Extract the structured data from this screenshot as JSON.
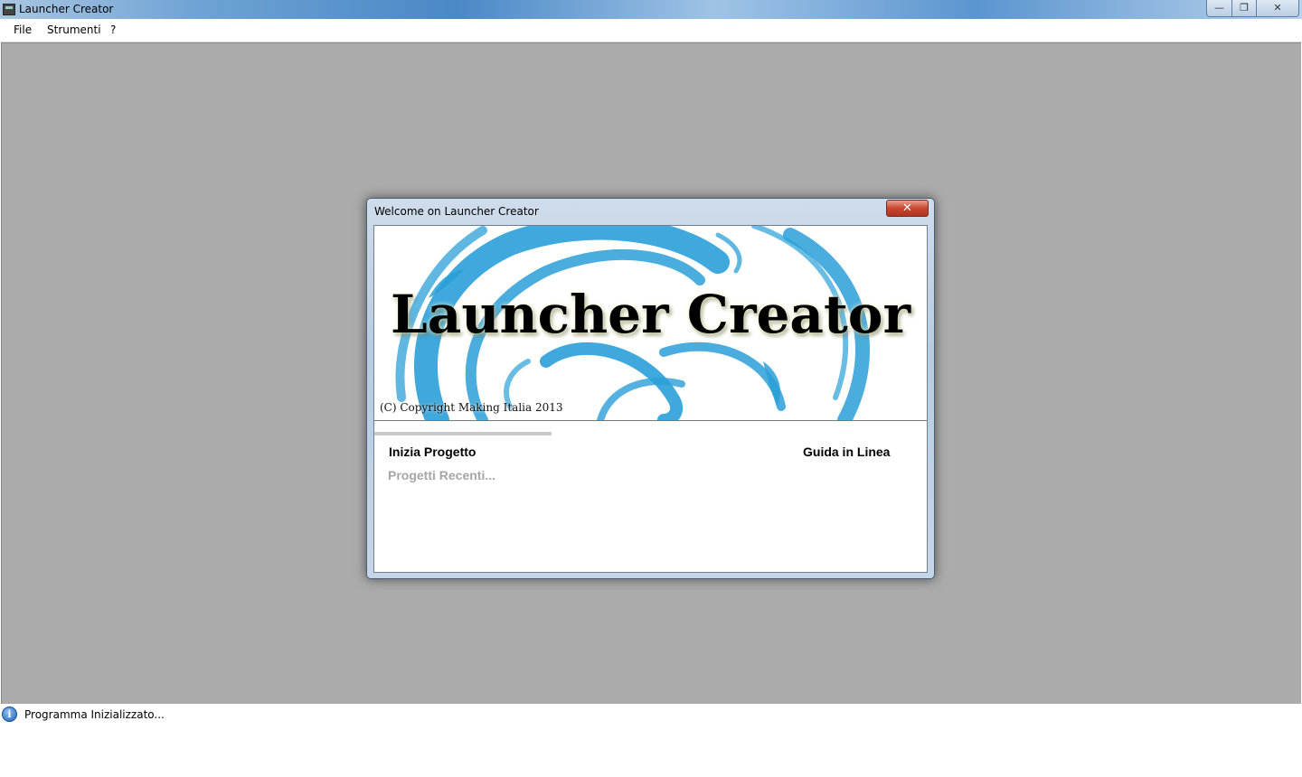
{
  "window": {
    "title": "Launcher Creator",
    "controls": {
      "minimize": "—",
      "maximize": "❐",
      "close": "✕"
    }
  },
  "menubar": {
    "items": [
      "File",
      "Strumenti",
      "?"
    ]
  },
  "dialog": {
    "title": "Welcome on Launcher Creator",
    "close_glyph": "✕",
    "banner": {
      "title": "Launcher Creator",
      "copyright": "(C) Copyright Making Italia 2013"
    },
    "links": {
      "start": "Inizia Progetto",
      "recent": "Progetti Recenti...",
      "help": "Guida in Linea"
    }
  },
  "statusbar": {
    "icon": "info-icon",
    "text": "Programma Inizializzato..."
  },
  "colors": {
    "mdi_background": "#ababab",
    "swirl_blue": "#2a9fd8",
    "recent_gray": "#a6a6a6"
  }
}
